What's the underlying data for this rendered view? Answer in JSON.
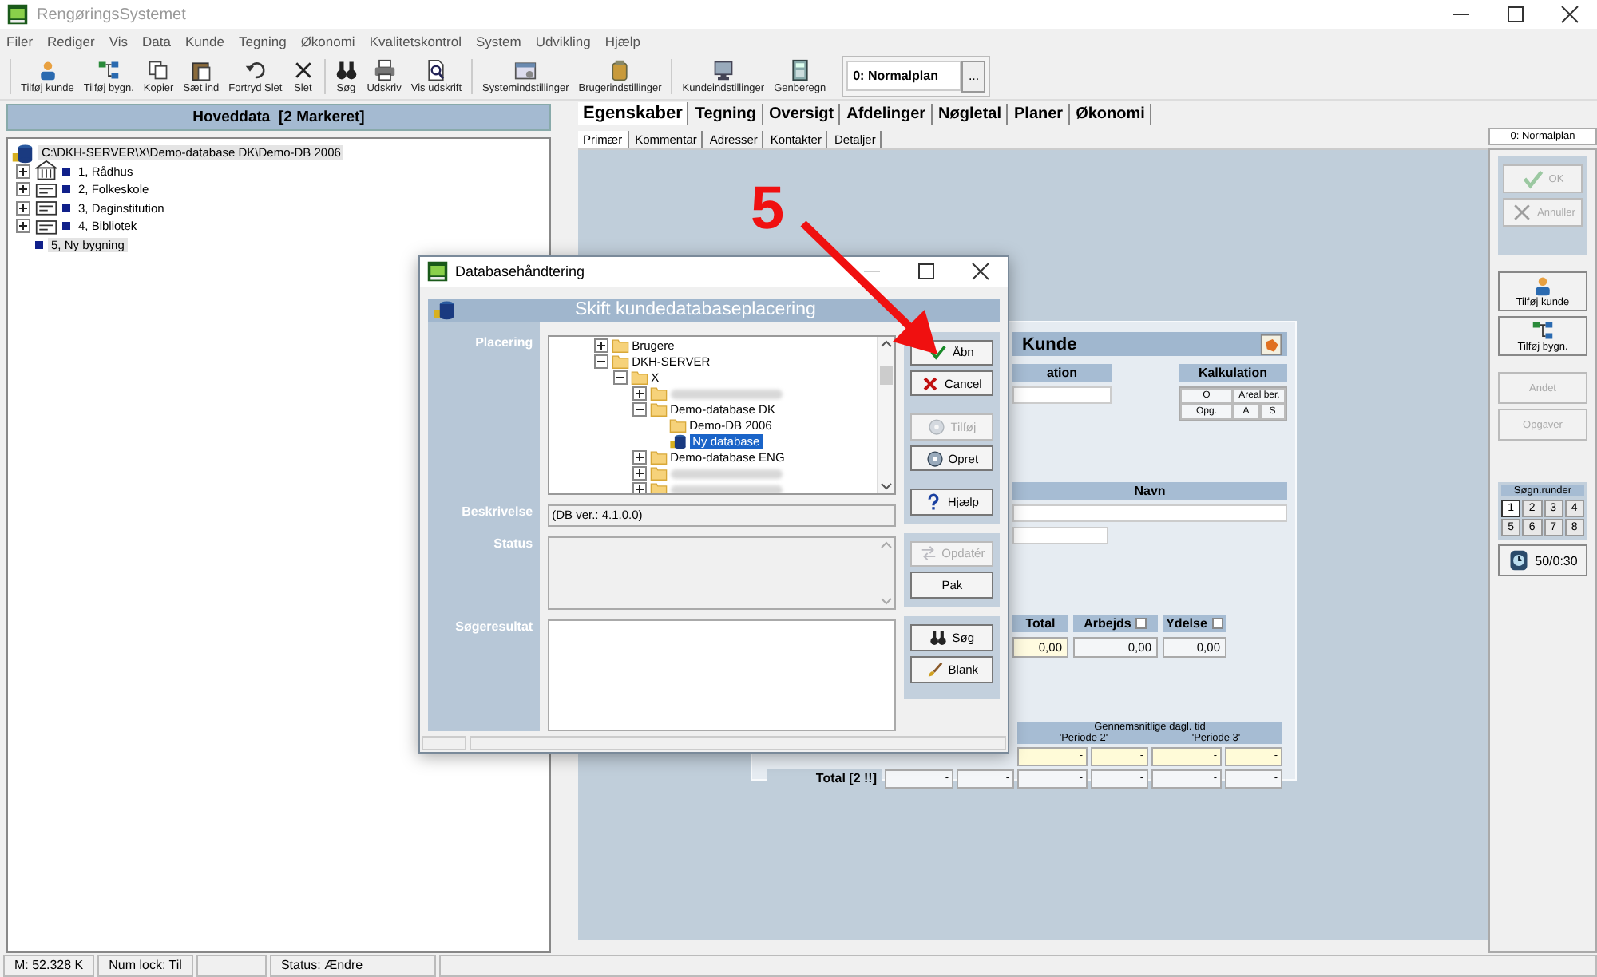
{
  "window": {
    "title": "RengøringsSystemet"
  },
  "menu": [
    "Filer",
    "Rediger",
    "Vis",
    "Data",
    "Kunde",
    "Tegning",
    "Økonomi",
    "Kvalitetskontrol",
    "System",
    "Udvikling",
    "Hjælp"
  ],
  "toolbar": {
    "groups": [
      [
        {
          "label": "Tilføj kunde"
        },
        {
          "label": "Tilføj bygn."
        },
        {
          "label": "Kopier"
        },
        {
          "label": "Sæt ind"
        },
        {
          "label": "Fortryd Slet"
        },
        {
          "label": "Slet"
        }
      ],
      [
        {
          "label": "Søg"
        },
        {
          "label": "Udskriv"
        },
        {
          "label": "Vis udskrift"
        }
      ],
      [
        {
          "label": "Systemindstillinger"
        },
        {
          "label": "Brugerindstillinger"
        }
      ],
      [
        {
          "label": "Kundeindstillinger"
        },
        {
          "label": "Genberegn"
        }
      ]
    ],
    "plan_combo": {
      "value": "0: Normalplan",
      "button": "..."
    }
  },
  "left_panel": {
    "header": "Hoveddata  [2 Markeret]",
    "tree": {
      "label": "C:\\DKH-SERVER\\X\\Demo-database DK\\Demo-DB 2006",
      "selected": true,
      "children": [
        {
          "label": "1, Rådhus",
          "expanded": false,
          "selected": false
        },
        {
          "label": "2, Folkeskole",
          "expanded": false,
          "selected": false
        },
        {
          "label": "3, Daginstitution",
          "expanded": false,
          "selected": false
        },
        {
          "label": "4, Bibliotek",
          "expanded": false,
          "selected": false
        },
        {
          "label": "5, Ny bygning",
          "selected": true
        }
      ]
    }
  },
  "tabs": [
    {
      "label": "Egenskaber",
      "selected": true
    },
    {
      "label": "Tegning",
      "selected": false
    },
    {
      "label": "Oversigt",
      "selected": false
    },
    {
      "label": "Afdelinger",
      "selected": false
    },
    {
      "label": "Nøgletal",
      "selected": false
    },
    {
      "label": "Planer",
      "selected": false
    },
    {
      "label": "Økonomi",
      "selected": false
    }
  ],
  "subtabs": [
    {
      "label": "Primær",
      "selected": true
    },
    {
      "label": "Kommentar",
      "selected": false
    },
    {
      "label": "Adresser",
      "selected": false
    },
    {
      "label": "Kontakter",
      "selected": false
    },
    {
      "label": "Detaljer",
      "selected": false
    }
  ],
  "form": {
    "title": "Kunde",
    "section_header": "ation",
    "calc": {
      "title": "Kalkulation",
      "rows": [
        [
          "O",
          "Areal ber."
        ],
        [
          "Opg.",
          "A",
          "S"
        ]
      ]
    },
    "name_header": "Navn",
    "totals": [
      {
        "label": "Total",
        "value": "0,00",
        "kind": "highlight"
      },
      {
        "label": "Arbejds",
        "value": "0,00",
        "kind": "plain"
      },
      {
        "label": "Ydelse",
        "value": "0,00",
        "kind": "plain"
      }
    ],
    "period_table": {
      "group_header": "Gennemsnitlige dagl. tid",
      "columns": [
        "'Periode 2'",
        "'Periode 3'"
      ],
      "row_cells": [
        "-",
        "-",
        "-",
        "-"
      ],
      "total_label": "Total [2 !!]",
      "total_cells": [
        "-",
        "-",
        "-",
        "-",
        "-",
        "-"
      ]
    }
  },
  "side_panel": {
    "tab": "0: Normalplan",
    "groups": [
      [
        {
          "label": "OK",
          "disabled": true
        },
        {
          "label": "Annuller",
          "disabled": true
        }
      ],
      [
        {
          "label": "Tilføj kunde",
          "disabled": false
        },
        {
          "label": "Tilføj bygn.",
          "disabled": false
        }
      ],
      [
        {
          "label": "Andet",
          "disabled": true
        },
        {
          "label": "Opgaver",
          "disabled": true
        }
      ]
    ],
    "rounds": {
      "title": "Søgn.runder",
      "items": [
        {
          "label": "1",
          "selected": true
        },
        {
          "label": "2",
          "selected": false
        },
        {
          "label": "3",
          "selected": false
        },
        {
          "label": "4",
          "selected": false
        },
        {
          "label": "5",
          "selected": false
        },
        {
          "label": "6",
          "selected": false
        },
        {
          "label": "7",
          "selected": false
        },
        {
          "label": "8",
          "selected": false
        }
      ]
    },
    "timer_button": "50/0:30"
  },
  "dialog": {
    "title": "Databasehåndtering",
    "header": "Skift kundedatabaseplacering",
    "labels": [
      "Placering",
      "Beskrivelse",
      "Status",
      "Søgeresultat"
    ],
    "tree": [
      {
        "label": "Brugere",
        "kind": "folder",
        "expanded": false,
        "selected": false
      },
      {
        "label": "DKH-SERVER",
        "kind": "folder",
        "expanded": true,
        "selected": false,
        "children": [
          {
            "label": "X",
            "kind": "folder",
            "expanded": true,
            "selected": false,
            "children": [
              {
                "kind": "redacted",
                "expanded": false,
                "selected": false
              },
              {
                "label": "Demo-database DK",
                "kind": "folder",
                "expanded": true,
                "selected": false,
                "children": [
                  {
                    "label": "Demo-DB 2006",
                    "kind": "folder",
                    "selected": false
                  },
                  {
                    "label": "Ny database",
                    "kind": "database",
                    "selected": true
                  }
                ]
              },
              {
                "label": "Demo-database ENG",
                "kind": "folder",
                "expanded": false,
                "selected": false
              },
              {
                "kind": "redacted",
                "expanded": false,
                "selected": false
              },
              {
                "kind": "redacted",
                "expanded": false,
                "selected": false
              }
            ]
          }
        ]
      }
    ],
    "description": "(DB ver.: 4.1.0.0)",
    "button_groups": [
      [
        {
          "label": "Åbn",
          "disabled": false
        },
        {
          "label": "Cancel",
          "disabled": false
        },
        {
          "label": "Tilføj",
          "disabled": true
        },
        {
          "label": "Opret",
          "disabled": false
        },
        {
          "label": "Hjælp",
          "disabled": false
        }
      ],
      [
        {
          "label": "Opdatér",
          "disabled": true
        },
        {
          "label": "Pak",
          "disabled": false
        }
      ],
      [
        {
          "label": "Søg",
          "disabled": false
        },
        {
          "label": "Blank",
          "disabled": false
        }
      ]
    ]
  },
  "annotation": {
    "label": "5"
  },
  "status_bar": [
    "M: 52.328 K",
    "Num lock: Til",
    "Status: Ændre"
  ]
}
